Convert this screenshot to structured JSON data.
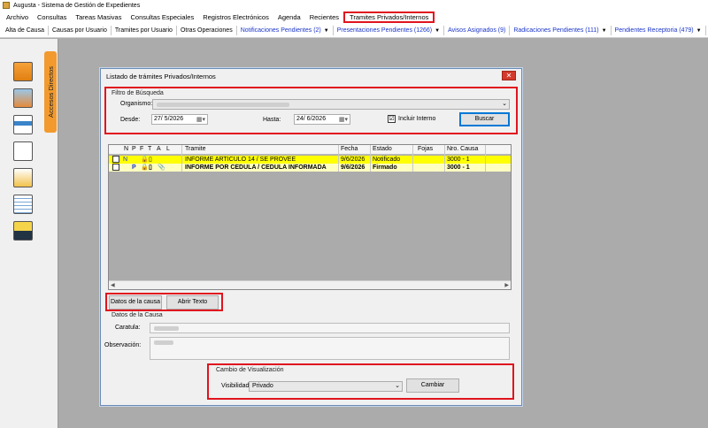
{
  "window": {
    "title": "Augusta - Sistema de Gestión de Expedientes"
  },
  "menu": [
    {
      "label": "Archivo"
    },
    {
      "label": "Consultas"
    },
    {
      "label": "Tareas Masivas"
    },
    {
      "label": "Consultas Especiales"
    },
    {
      "label": "Registros Electrónicos"
    },
    {
      "label": "Agenda"
    },
    {
      "label": "Recientes"
    },
    {
      "label": "Tramites Privados/Internos"
    }
  ],
  "toolbar": [
    {
      "label": "Alta de Causa"
    },
    {
      "label": "Causas por Usuario"
    },
    {
      "label": "Tramites por Usuario"
    },
    {
      "label": "Otras Operaciones"
    },
    {
      "label": "Notificaciones Pendientes (2)"
    },
    {
      "label": "Presentaciones Pendientes (1266)"
    },
    {
      "label": "Avisos Asignados (9)"
    },
    {
      "label": "Radicaciones Pendientes (111)"
    },
    {
      "label": "Pendientes Receptoria (479)"
    }
  ],
  "sidebar": {
    "tab_label": "Accesos Directos"
  },
  "dialog": {
    "title": "Listado de trámites Privados/Internos",
    "filter": {
      "group_label": "Filtro de Búsqueda",
      "organismo_label": "Organismo:",
      "desde_label": "Desde:",
      "desde_value": "27/ 5/2026",
      "hasta_label": "Hasta:",
      "hasta_value": "24/ 6/2026",
      "incluir_interno_label": "Incluir Interno",
      "incluir_interno_checked": "☑",
      "buscar_label": "Buscar"
    },
    "grid": {
      "headers": [
        "N",
        "P",
        "F",
        "T",
        "A",
        "L",
        "Tramite",
        "Fecha",
        "Estado",
        "Fojas",
        "Nro. Causa"
      ],
      "rows": [
        {
          "tramite": "INFORME ARTICULO 14 / SE PROVEE",
          "fecha": "9/6/2026",
          "estado": "Notificado",
          "fojas": "",
          "nro_causa": "3000 - 1"
        },
        {
          "tramite": "INFORME POR CEDULA / CEDULA INFORMADA",
          "fecha": "9/6/2026",
          "estado": "Firmado",
          "fojas": "",
          "nro_causa": "3000 - 1"
        }
      ]
    },
    "buttons": {
      "datos_causa": "Datos de la causa",
      "abrir_texto": "Abrir Texto"
    },
    "causa": {
      "group_label": "Datos de la Causa",
      "caratula_label": "Caratula:",
      "observacion_label": "Observación:"
    },
    "visualizacion": {
      "group_label": "Cambio de Visualización",
      "visibilidad_label": "Visibilidad",
      "visibilidad_value": "Privado",
      "cambiar_label": "Cambiar"
    }
  },
  "colors": {
    "highlight_red": "#e0141e",
    "row_yellow": "#ffff00",
    "link_blue": "#1a35c8",
    "sidebar_tab": "#f29a2e"
  }
}
